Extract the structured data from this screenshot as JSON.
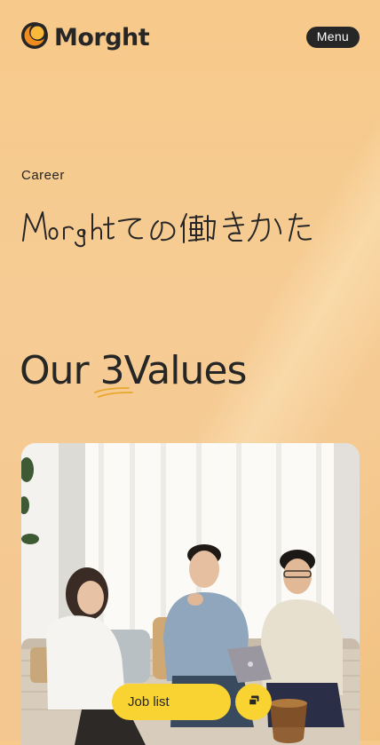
{
  "header": {
    "brand": "Morght",
    "logo_icon": "crescent-moon-logo",
    "menu_label": "Menu"
  },
  "hero": {
    "eyebrow": "Career",
    "script_title": "Morghtの働きかた"
  },
  "values": {
    "title_prefix": "Our ",
    "title_number": "3",
    "title_suffix": "Values"
  },
  "photo": {
    "description_icon": "team-meeting-photo"
  },
  "cta": {
    "job_list_label": "Job list",
    "secondary_icon": "external-window-icon"
  },
  "colors": {
    "background": "#f7c98a",
    "accent_yellow": "#f9d331",
    "logo_orange": "#f08c1e",
    "ink": "#262626"
  }
}
